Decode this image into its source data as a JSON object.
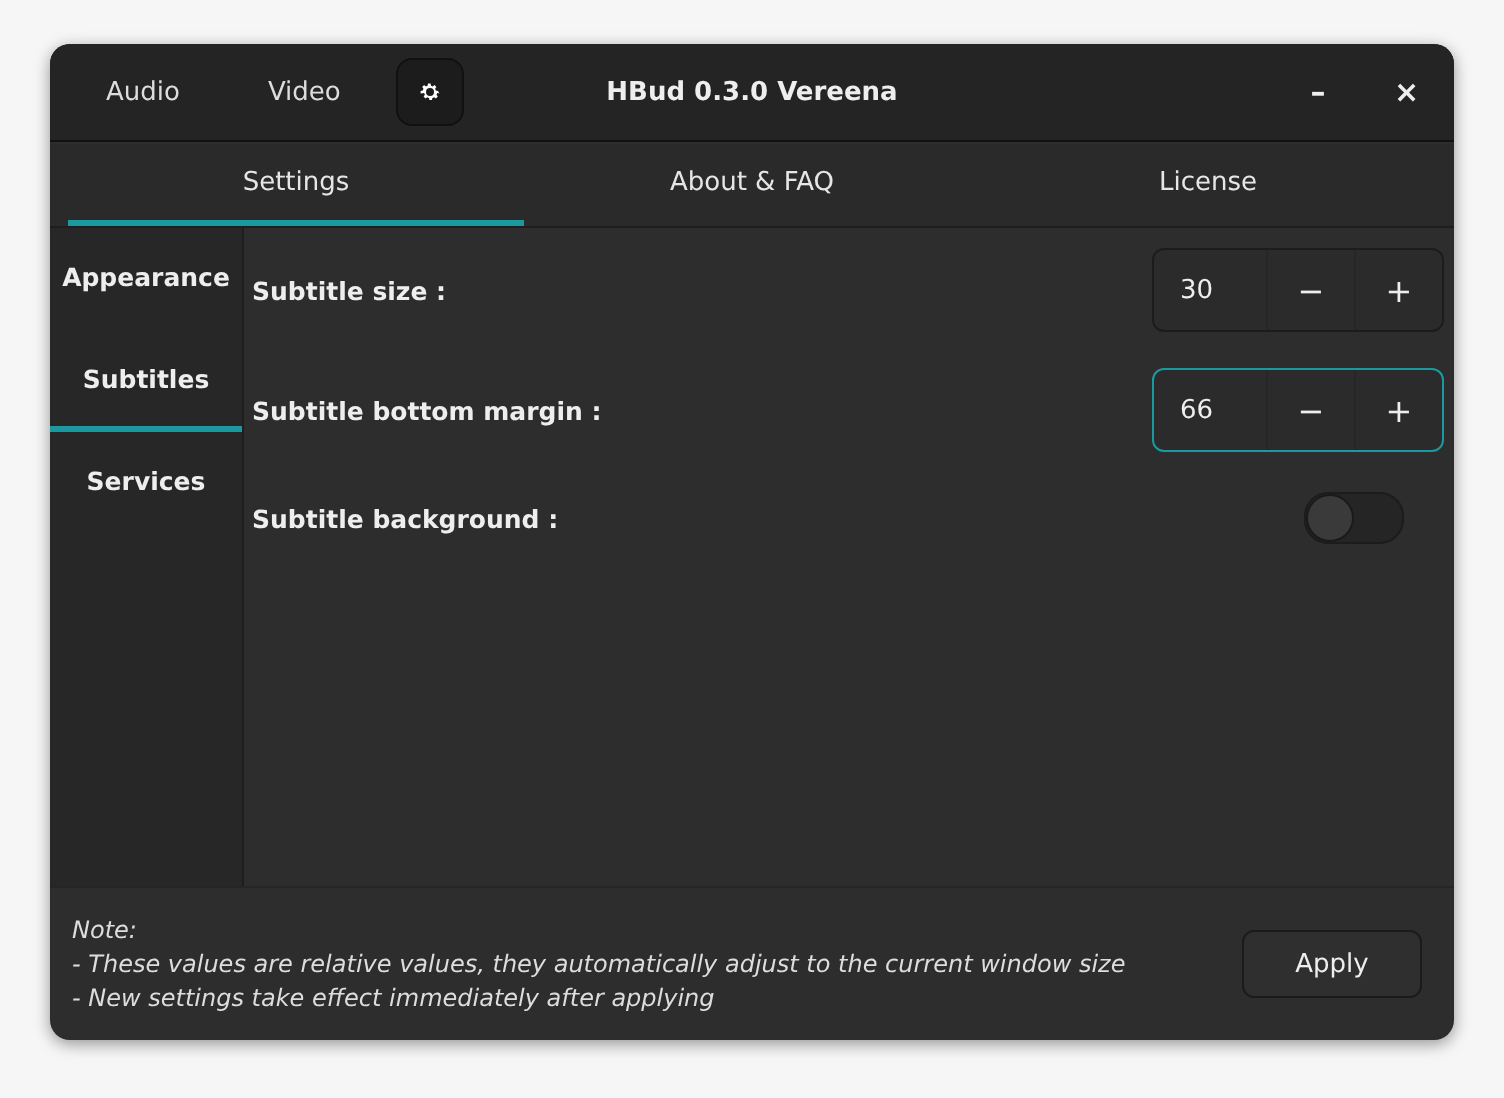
{
  "header": {
    "buttons": [
      {
        "label": "Audio"
      },
      {
        "label": "Video"
      }
    ],
    "title": "HBud 0.3.0 Vereena",
    "minimize": "–",
    "close": "×"
  },
  "tabs": [
    {
      "label": "Settings",
      "selected": true
    },
    {
      "label": "About & FAQ",
      "selected": false
    },
    {
      "label": "License",
      "selected": false
    }
  ],
  "sidebar": {
    "items": [
      {
        "label": "Appearance",
        "selected": false
      },
      {
        "label": "Subtitles",
        "selected": true
      },
      {
        "label": "Services",
        "selected": false
      }
    ]
  },
  "settings": [
    {
      "kind": "spin",
      "label": "Subtitle size :",
      "value": "30",
      "focused": false,
      "minus": "−",
      "plus": "+"
    },
    {
      "kind": "spin",
      "label": "Subtitle bottom margin :",
      "value": "66",
      "focused": true,
      "minus": "−",
      "plus": "+"
    },
    {
      "kind": "switch",
      "label": "Subtitle background :",
      "on": false
    }
  ],
  "note": [
    "Note:",
    "- These values are relative values, they automatically adjust to the current window size",
    "- New settings take effect immediately after applying"
  ],
  "apply_button": "Apply"
}
